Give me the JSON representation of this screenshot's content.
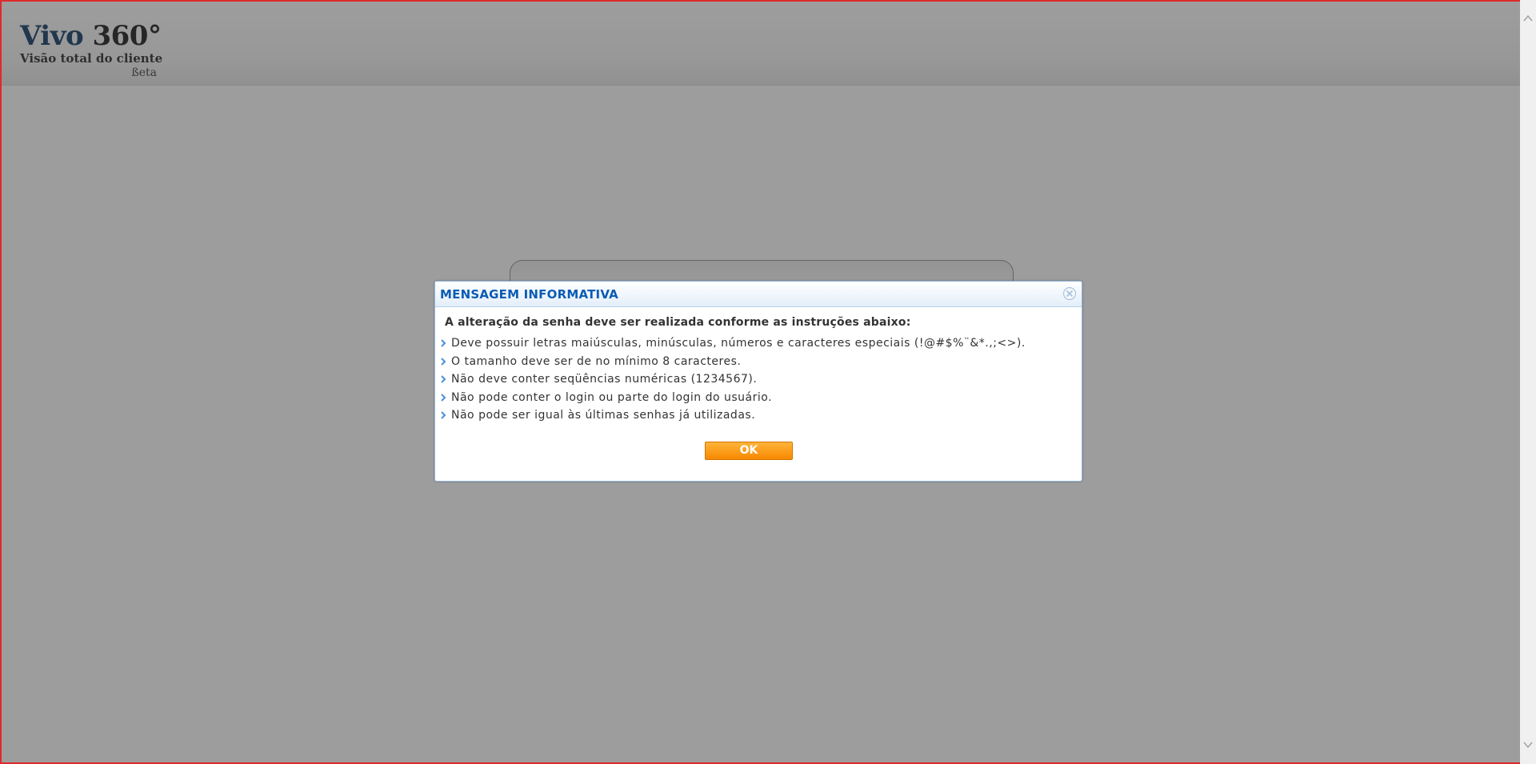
{
  "header": {
    "logo_brand": "Vivo",
    "logo_number": "360°",
    "logo_subtitle": "Visão total do cliente",
    "logo_beta": "ßeta"
  },
  "dialog": {
    "title": "MENSAGEM INFORMATIVA",
    "heading": "A alteração da senha deve ser realizada conforme as instruções abaixo:",
    "rules": [
      "Deve possuir letras maiúsculas, minúsculas, números e caracteres especiais (!@#$%¨&*.,;<>).",
      "O tamanho deve ser de no mínimo 8 caracteres.",
      "Não deve conter seqüências numéricas (1234567).",
      "Não pode conter o login ou parte do login do usuário.",
      "Não pode ser igual às últimas senhas já utilizadas."
    ],
    "ok_label": "OK"
  },
  "icons": {
    "close": "close-icon",
    "bullet": "chevron-right-icon",
    "scroll_up": "chevron-up-icon",
    "scroll_down": "chevron-down-icon"
  },
  "colors": {
    "title_blue": "#0a5cb5",
    "button_orange": "#f78800",
    "frame_red": "#e02a2a",
    "brand_navy": "#06325f"
  }
}
